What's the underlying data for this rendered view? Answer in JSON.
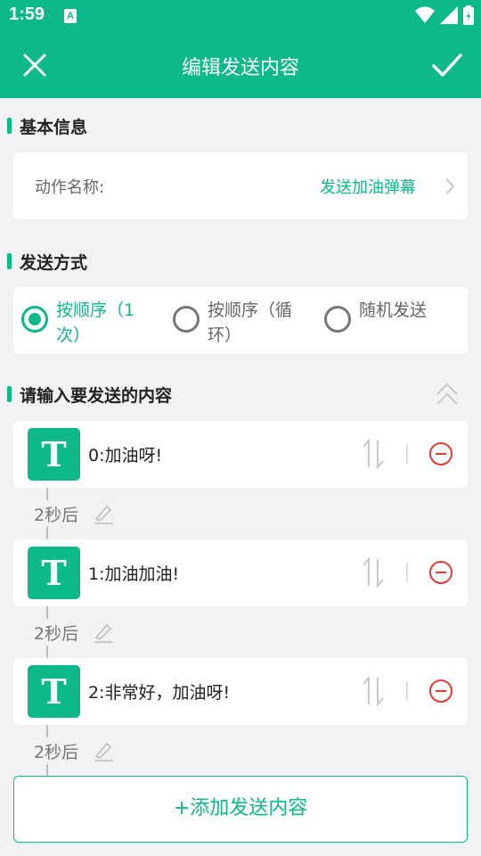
{
  "status": {
    "time": "1:59",
    "notification": "A"
  },
  "appbar": {
    "title": "编辑发送内容"
  },
  "sections": {
    "basic": "基本信息",
    "method": "发送方式",
    "content": "请输入要发送的内容"
  },
  "action_field": {
    "label": "动作名称:",
    "value": "发送加油弹幕"
  },
  "send_modes": [
    {
      "label": "按顺序（1次）",
      "selected": true
    },
    {
      "label": "按顺序（循环）",
      "selected": false
    },
    {
      "label": "随机发送",
      "selected": false
    }
  ],
  "messages": [
    {
      "icon": "T",
      "text": "0:加油呀!"
    },
    {
      "icon": "T",
      "text": "1:加油加油!"
    },
    {
      "icon": "T",
      "text": "2:非常好，加油呀!"
    }
  ],
  "delays": [
    "2秒后",
    "2秒后",
    "2秒后"
  ],
  "add_button": "+添加发送内容",
  "colors": {
    "accent": "#0db889",
    "delete": "#e53935"
  }
}
